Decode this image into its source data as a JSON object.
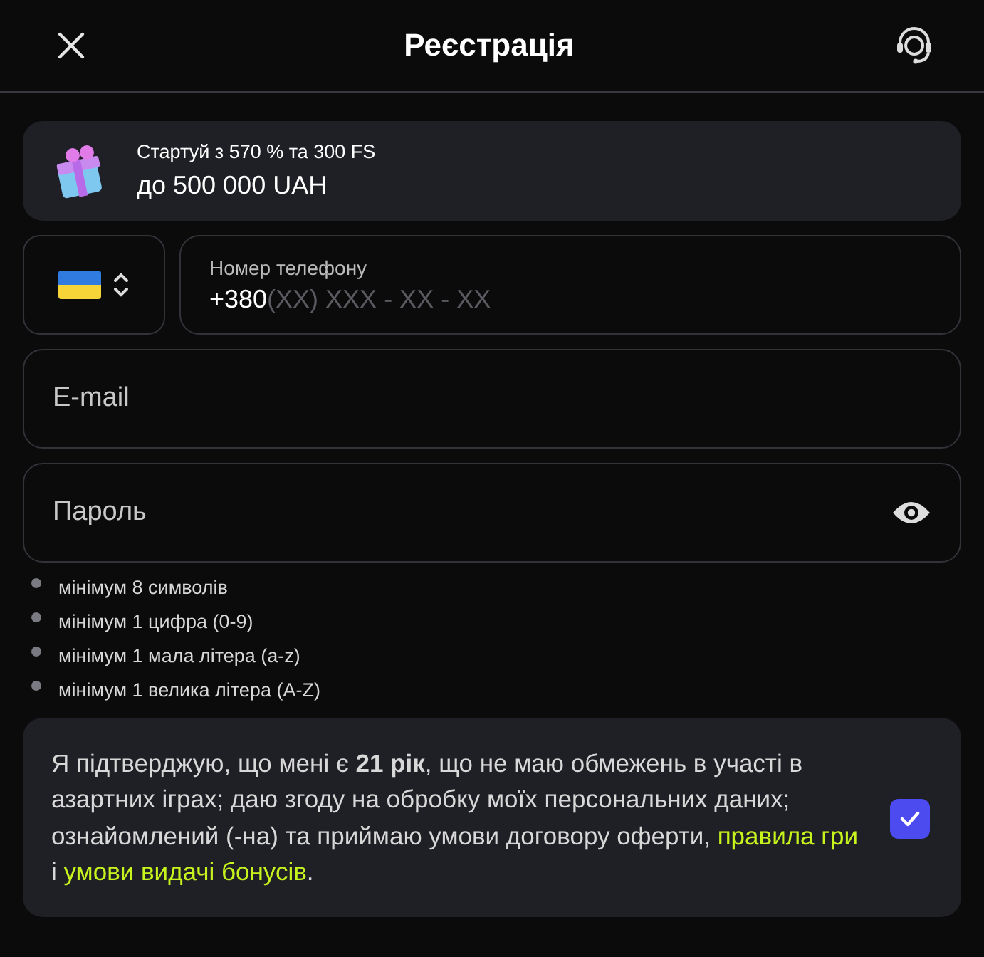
{
  "header": {
    "title": "Реєстрація"
  },
  "promo": {
    "line_1": "Стартуй з 570 % та 300 FS",
    "line_2": "до 500 000 UAH"
  },
  "phone": {
    "label": "Номер телефону",
    "prefix": "+380",
    "placeholder": "(XX) XXX - XX - XX"
  },
  "email": {
    "placeholder": "E-mail"
  },
  "password": {
    "placeholder": "Пароль"
  },
  "requirements": [
    {
      "text": "мінімум 8 символів",
      "met": false
    },
    {
      "text": "мінімум 1 цифра (0-9)",
      "met": false
    },
    {
      "text": "мінімум 1 мала літера (a-z)",
      "met": false
    },
    {
      "text": "мінімум 1 велика літера (A-Z)",
      "met": false
    }
  ],
  "consent": {
    "checked": true,
    "parts": [
      {
        "kind": "text",
        "text": "Я підтверджую, що мені є **21 рік**, що не маю обмежень в участі в азартних іграх; даю згоду на обробку моїх персональних даних; ознайомлений (-на) та приймаю умови договору оферти, "
      },
      {
        "kind": "link",
        "text": "правила гри"
      },
      {
        "kind": "text",
        "text": " і "
      },
      {
        "kind": "link",
        "text": "умови видачі бонусів"
      },
      {
        "kind": "text",
        "text": "."
      }
    ]
  }
}
